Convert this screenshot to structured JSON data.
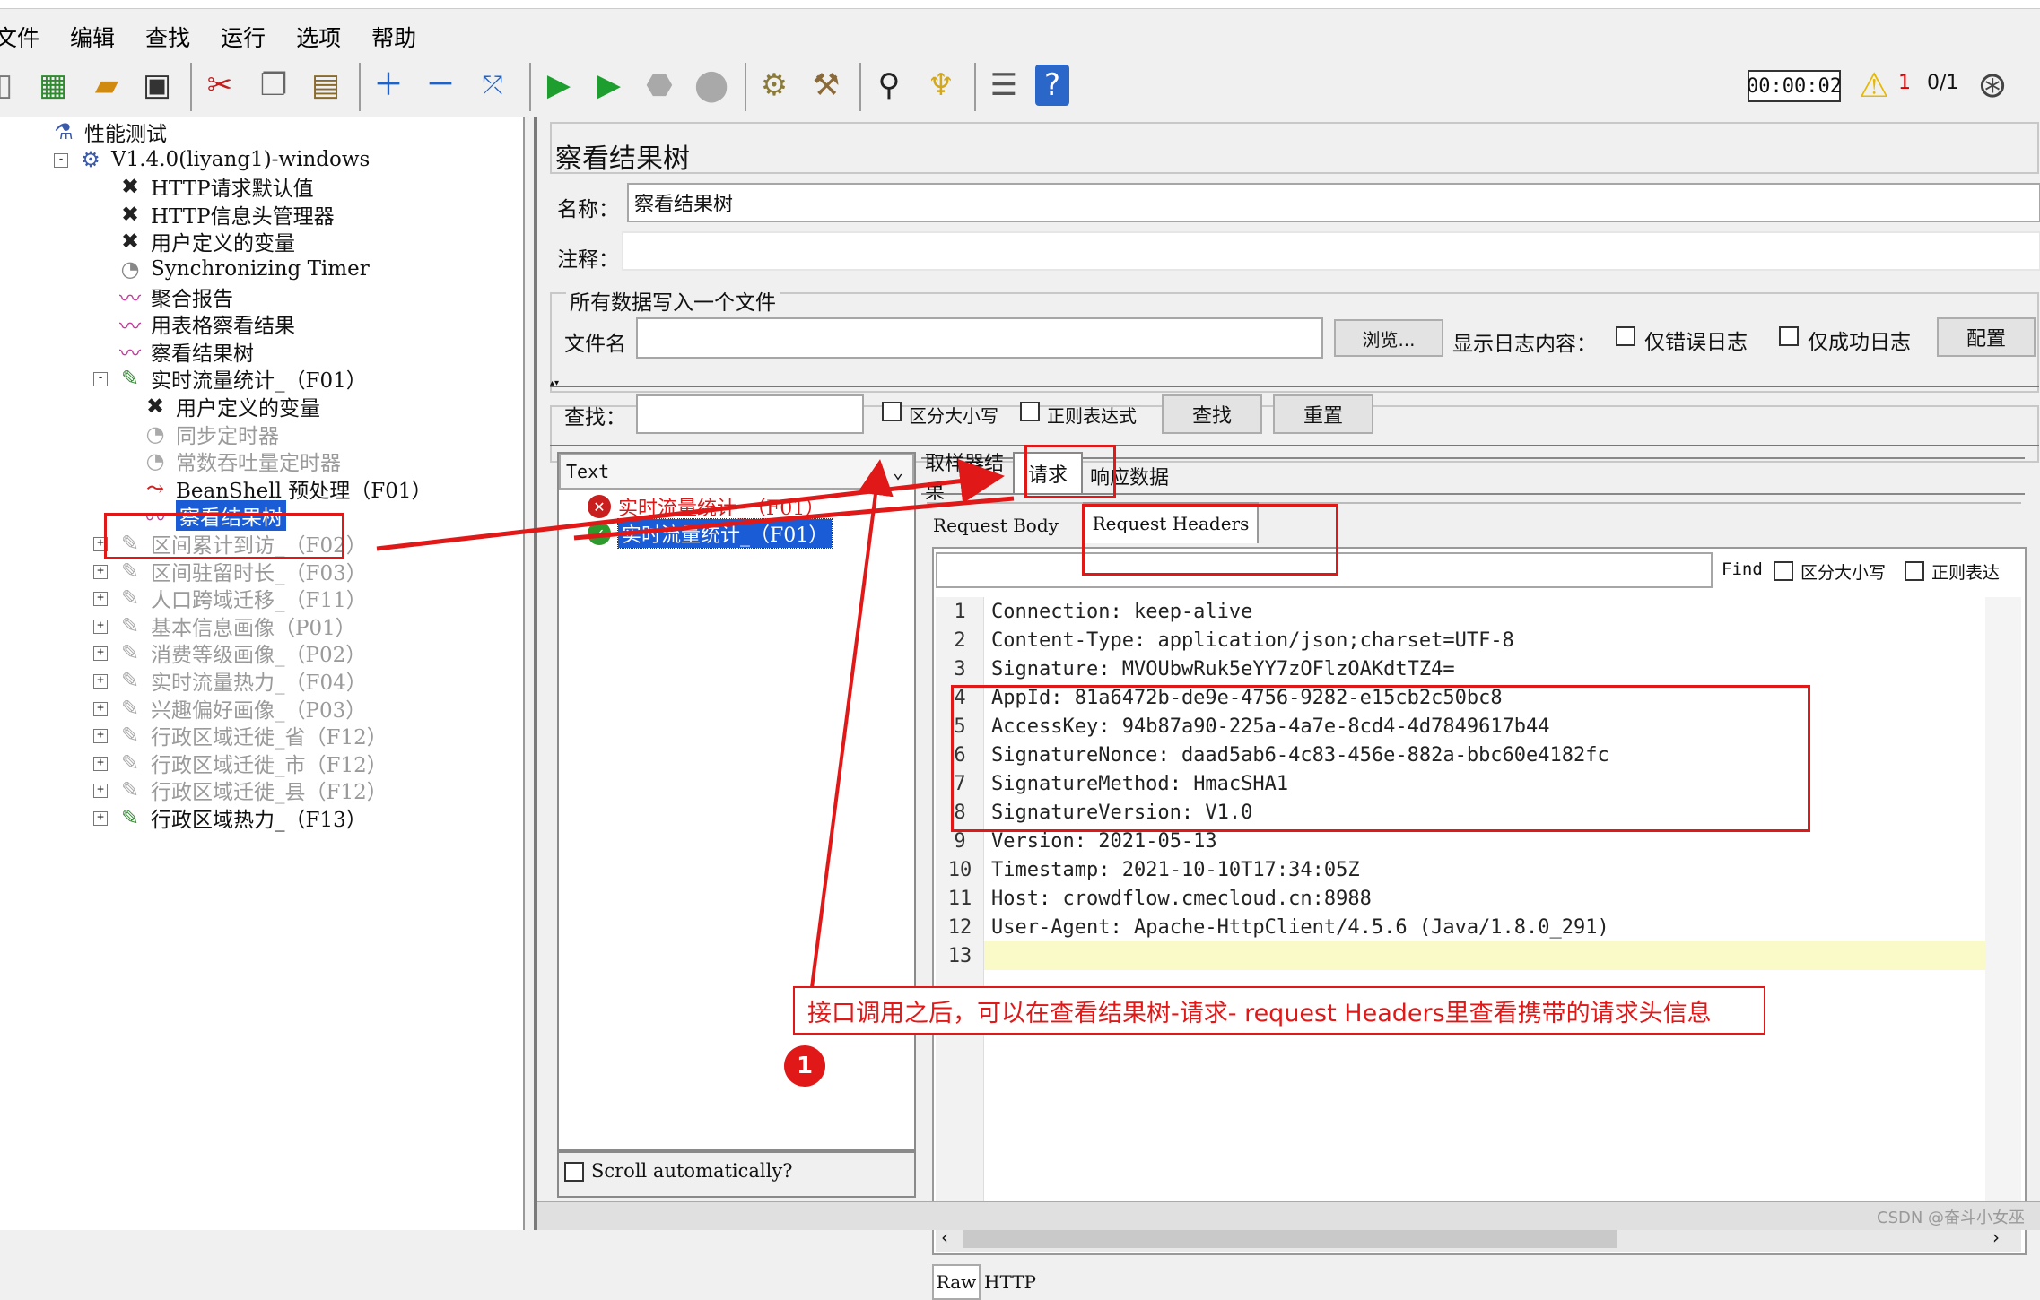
{
  "menu": [
    "文件",
    "编辑",
    "查找",
    "运行",
    "选项",
    "帮助"
  ],
  "toolbar": {
    "timer": "00:00:02",
    "warning_count": "1",
    "threads": "0/1",
    "icons": [
      "new-icon",
      "templates-icon",
      "open-icon",
      "save-icon",
      "cut-icon",
      "copy-icon",
      "paste-icon",
      "expand-icon",
      "collapse-icon",
      "toggle-icon",
      "start-icon",
      "start-no-pause-icon",
      "stop-icon",
      "shutdown-icon",
      "clear-icon",
      "clear-all-icon",
      "search-icon",
      "reset-search-icon",
      "function-helper-icon",
      "help-icon",
      "remote-icon"
    ]
  },
  "tree": {
    "items": [
      {
        "label": "性能测试",
        "icon": "testplan-icon",
        "state": "normal"
      },
      {
        "label": "V1.4.0(liyang1)-windows",
        "icon": "thread-group-icon",
        "state": "normal"
      },
      {
        "label": "HTTP请求默认值",
        "icon": "config-icon",
        "state": "normal"
      },
      {
        "label": "HTTP信息头管理器",
        "icon": "config-icon",
        "state": "normal"
      },
      {
        "label": "用户定义的变量",
        "icon": "config-icon",
        "state": "normal"
      },
      {
        "label": "Synchronizing Timer",
        "icon": "timer-icon",
        "state": "normal"
      },
      {
        "label": "聚合报告",
        "icon": "listener-icon",
        "state": "normal"
      },
      {
        "label": "用表格察看结果",
        "icon": "listener-icon",
        "state": "normal"
      },
      {
        "label": "察看结果树",
        "icon": "listener-icon",
        "state": "normal"
      },
      {
        "label": "实时流量统计_（F01）",
        "icon": "sampler-icon",
        "state": "normal"
      },
      {
        "label": "用户定义的变量",
        "icon": "config-icon",
        "state": "normal"
      },
      {
        "label": "同步定时器",
        "icon": "timer-icon",
        "state": "disabled"
      },
      {
        "label": "常数吞吐量定时器",
        "icon": "timer-icon",
        "state": "disabled"
      },
      {
        "label": "BeanShell 预处理（F01）",
        "icon": "preprocessor-icon",
        "state": "normal"
      },
      {
        "label": "察看结果树",
        "icon": "listener-icon",
        "state": "selected"
      },
      {
        "label": "区间累计到访_（F02）",
        "icon": "sampler-icon",
        "state": "disabled"
      },
      {
        "label": "区间驻留时长_（F03）",
        "icon": "sampler-icon",
        "state": "disabled"
      },
      {
        "label": "人口跨域迁移_（F11）",
        "icon": "sampler-icon",
        "state": "disabled"
      },
      {
        "label": "基本信息画像（P01）",
        "icon": "sampler-icon",
        "state": "disabled"
      },
      {
        "label": "消费等级画像_（P02）",
        "icon": "sampler-icon",
        "state": "disabled"
      },
      {
        "label": "实时流量热力_（F04）",
        "icon": "sampler-icon",
        "state": "disabled"
      },
      {
        "label": "兴趣偏好画像_（P03）",
        "icon": "sampler-icon",
        "state": "disabled"
      },
      {
        "label": "行政区域迁徙_省（F12）",
        "icon": "sampler-icon",
        "state": "disabled"
      },
      {
        "label": "行政区域迁徙_市（F12）",
        "icon": "sampler-icon",
        "state": "disabled"
      },
      {
        "label": "行政区域迁徙_县（F12）",
        "icon": "sampler-icon",
        "state": "disabled"
      },
      {
        "label": "行政区域热力_（F13）",
        "icon": "sampler-icon",
        "state": "normal"
      }
    ]
  },
  "panel": {
    "title": "察看结果树",
    "name_label": "名称：",
    "name_value": "察看结果树",
    "comment_label": "注释：",
    "file_section": "所有数据写入一个文件",
    "file_label": "文件名",
    "browse": "浏览...",
    "log_label": "显示日志内容：",
    "errors_only": "仅错误日志",
    "success_only": "仅成功日志",
    "configure": "配置",
    "search_label": "查找：",
    "case_sensitive": "区分大小写",
    "regex": "正则表达式",
    "search_btn": "查找",
    "reset_btn": "重置"
  },
  "results": {
    "renderer": "Text",
    "samples": [
      {
        "label": "实时流量统计_（F01）",
        "status": "error"
      },
      {
        "label": "实时流量统计_（F01）",
        "status": "success"
      }
    ],
    "scroll_label": "Scroll automatically?"
  },
  "detail": {
    "tabs": [
      "取样器结果",
      "请求",
      "响应数据"
    ],
    "subtabs": [
      "Request Body",
      "Request Headers"
    ],
    "find_label": "Find",
    "find_case": "区分大小写",
    "find_regex": "正则表达",
    "bottom_tabs": [
      "Raw",
      "HTTP"
    ],
    "lines": [
      {
        "n": "1",
        "key": "Connection",
        "value": "keep-alive"
      },
      {
        "n": "2",
        "key": "Content-Type",
        "value": "application/json;charset=UTF-8"
      },
      {
        "n": "3",
        "key": "Signature",
        "value": "MVOUbwRuk5eYY7zOFlzOAKdtTZ4="
      },
      {
        "n": "4",
        "key": "AppId",
        "value": "81a6472b-de9e-4756-9282-e15cb2c50bc8"
      },
      {
        "n": "5",
        "key": "AccessKey",
        "value": "94b87a90-225a-4a7e-8cd4-4d7849617b44"
      },
      {
        "n": "6",
        "key": "SignatureNonce",
        "value": "daad5ab6-4c83-456e-882a-bbc60e4182fc"
      },
      {
        "n": "7",
        "key": "SignatureMethod",
        "value": "HmacSHA1"
      },
      {
        "n": "8",
        "key": "SignatureVersion",
        "value": "V1.0"
      },
      {
        "n": "9",
        "key": "Version",
        "value": "2021-05-13"
      },
      {
        "n": "10",
        "key": "Timestamp",
        "value": "2021-10-10T17:34:05Z"
      },
      {
        "n": "11",
        "key": "Host",
        "value": "crowdflow.cmecloud.cn:8988"
      },
      {
        "n": "12",
        "key": "User-Agent",
        "value": "Apache-HttpClient/4.5.6 (Java/1.8.0_291)"
      },
      {
        "n": "13",
        "key": "",
        "value": ""
      }
    ]
  },
  "annotation": {
    "text": "接口调用之后，可以在查看结果树-请求- request Headers里查看携带的请求头信息",
    "badge": "1"
  },
  "watermark": "CSDN @奋斗小女巫",
  "colors": {
    "highlight": "#e01818",
    "selection": "#1a5cd6",
    "line_highlight": "#fafac8"
  }
}
